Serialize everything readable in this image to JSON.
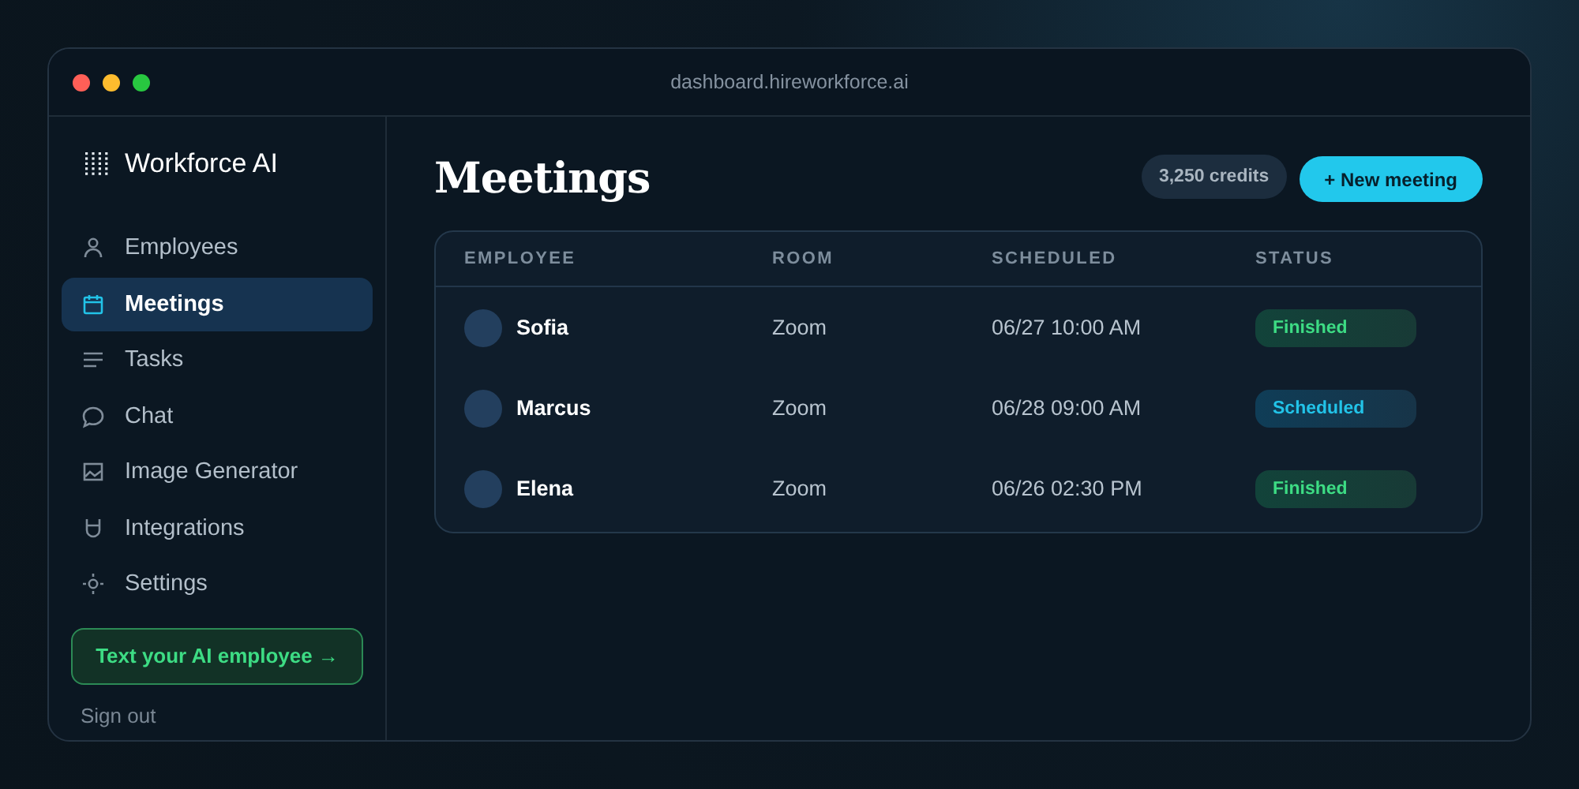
{
  "window": {
    "url": "dashboard.hireworkforce.ai"
  },
  "sidebar": {
    "brand": "Workforce AI",
    "items": [
      {
        "label": "Employees",
        "selected": false
      },
      {
        "label": "Meetings",
        "selected": true
      },
      {
        "label": "Tasks",
        "selected": false
      },
      {
        "label": "Chat",
        "selected": false
      },
      {
        "label": "Image Generator",
        "selected": false
      },
      {
        "label": "Integrations",
        "selected": false
      },
      {
        "label": "Settings",
        "selected": false
      }
    ],
    "cta": "Text your AI employee →",
    "sign_out": "Sign out"
  },
  "page": {
    "title": "Meetings",
    "credits": "3,250 credits",
    "new_button": "+ New meeting"
  },
  "table": {
    "columns": [
      "EMPLOYEE",
      "ROOM",
      "SCHEDULED",
      "STATUS"
    ],
    "rows": [
      {
        "employee": "Sofia",
        "room": "Zoom",
        "scheduled": "06/27 10:00 AM",
        "status": {
          "label": "Finished",
          "kind": "finished"
        }
      },
      {
        "employee": "Marcus",
        "room": "Zoom",
        "scheduled": "06/28 09:00 AM",
        "status": {
          "label": "Scheduled",
          "kind": "scheduled"
        }
      },
      {
        "employee": "Elena",
        "room": "Zoom",
        "scheduled": "06/26 02:30 PM",
        "status": {
          "label": "Finished",
          "kind": "finished"
        }
      }
    ]
  }
}
